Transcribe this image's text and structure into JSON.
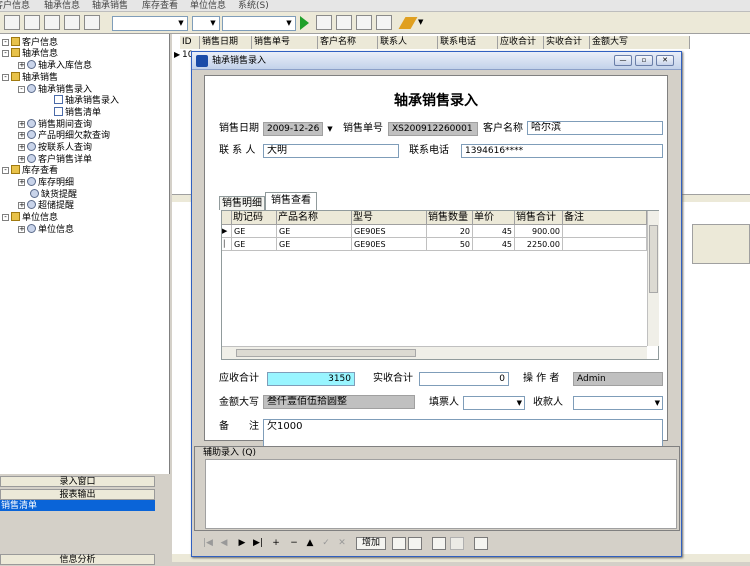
{
  "menubar": [
    "客户信息",
    "轴承信息",
    "轴承销售",
    "库存查看",
    "单位信息",
    "系统(S)"
  ],
  "tree": {
    "items": [
      {
        "label": "客户信息",
        "type": "folder",
        "expander": "-"
      },
      {
        "label": "轴承信息",
        "type": "folder",
        "expander": "-"
      },
      {
        "label": "轴承入库信息",
        "type": "gear",
        "expander": "+"
      },
      {
        "label": "轴承销售",
        "type": "folder",
        "expander": "-"
      },
      {
        "label": "轴承销售录入",
        "type": "gear",
        "expander": "-"
      },
      {
        "label": "轴承销售录入",
        "type": "doc",
        "expander": ""
      },
      {
        "label": "销售清单",
        "type": "doc",
        "expander": ""
      },
      {
        "label": "销售期间查询",
        "type": "gear",
        "expander": "+"
      },
      {
        "label": "产品明细欠款查询",
        "type": "gear",
        "expander": "+"
      },
      {
        "label": "按联系人查询",
        "type": "gear",
        "expander": "+"
      },
      {
        "label": "客户销售详单",
        "type": "gear",
        "expander": "+"
      },
      {
        "label": "库存查看",
        "type": "folder",
        "expander": "-"
      },
      {
        "label": "库存明细",
        "type": "gear",
        "expander": "+"
      },
      {
        "label": "缺货提醒",
        "type": "gear",
        "expander": ""
      },
      {
        "label": "超储提醒",
        "type": "gear",
        "expander": "+"
      },
      {
        "label": "单位信息",
        "type": "folder",
        "expander": "-"
      },
      {
        "label": "单位信息",
        "type": "gear",
        "expander": "+"
      }
    ]
  },
  "sidebar_buttons": [
    "录入窗口",
    "报表输出",
    "销售清单",
    "信息分析"
  ],
  "background_grid": {
    "headers": [
      "ID",
      "销售日期",
      "销售单号",
      "客户名称",
      "联系人",
      "联系电话",
      "应收合计",
      "实收合计",
      "金额大写"
    ],
    "first_id": "10"
  },
  "dialog": {
    "title": "轴承销售录入",
    "form_title": "轴承销售录入",
    "sale_date_label": "销售日期",
    "sale_date": "2009-12-26",
    "sale_no_label": "销售单号",
    "sale_no": "XS200912260001",
    "customer_label": "客户名称",
    "customer": "哈尔滨",
    "contact_label": "联 系 人",
    "contact": "大明",
    "phone_label": "联系电话",
    "phone": "1394616****",
    "tabs": [
      "销售明细",
      "销售查看"
    ],
    "grid": {
      "headers": [
        "助记码",
        "产品名称",
        "型号",
        "销售数量",
        "单价",
        "销售合计",
        "备注"
      ],
      "rows": [
        {
          "code": "GE",
          "name": "GE",
          "model": "GE90ES",
          "qty": "20",
          "price": "45",
          "total": "900.00",
          "note": ""
        },
        {
          "code": "GE",
          "name": "GE",
          "model": "GE90ES",
          "qty": "50",
          "price": "45",
          "total": "2250.00",
          "note": ""
        }
      ]
    },
    "receivable_label": "应收合计",
    "receivable": "3150",
    "received_label": "实收合计",
    "received": "0",
    "operator_label": "操 作 者",
    "operator": "Admin",
    "amount_words_label": "金额大写",
    "amount_words": "叁仟壹佰伍拾圆整",
    "filler_label": "填票人",
    "payee_label": "收款人",
    "remark_label": "备　　注",
    "remark": "欠1000",
    "aux_label": "辅助录入 (Q)",
    "nav_add": "增加"
  },
  "colors": {
    "titlebar": "#c3d2ea",
    "highlight_cyan": "#99f5ff",
    "selection": "#0a64d8"
  }
}
